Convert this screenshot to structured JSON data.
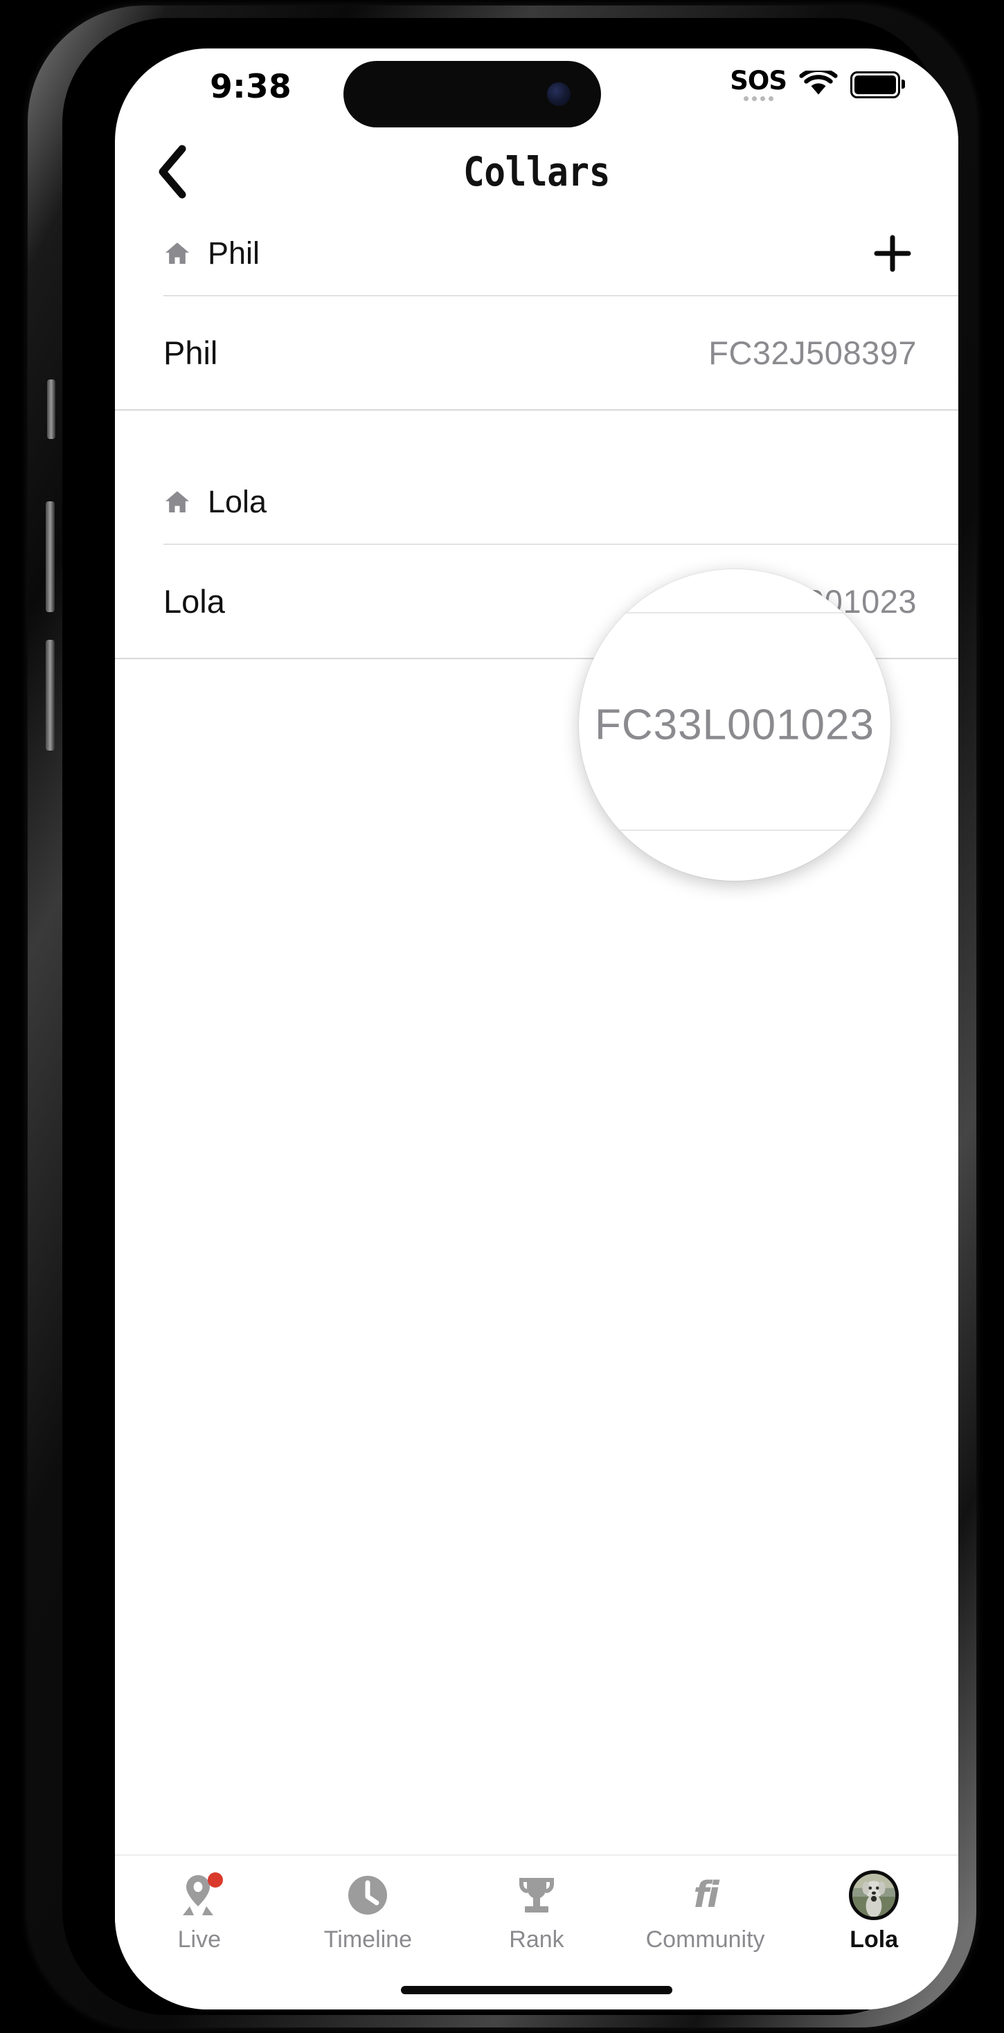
{
  "status_bar": {
    "time": "9:38",
    "sos_label": "SOS",
    "wifi_icon": "wifi-icon",
    "battery_icon": "battery-full-icon"
  },
  "nav": {
    "back_icon": "chevron-left-icon",
    "title": "Collars"
  },
  "colors": {
    "accent_badge": "#d93a2b",
    "muted_text": "#8b8b8f",
    "primary_text": "#111111",
    "divider": "#e2e2e4"
  },
  "groups": [
    {
      "house_icon": "home-icon",
      "name": "Phil",
      "add_icon": "plus-icon",
      "add_label": "+",
      "collars": [
        {
          "name": "Phil",
          "serial": "FC32J508397"
        }
      ]
    },
    {
      "house_icon": "home-icon",
      "name": "Lola",
      "collars": [
        {
          "name": "Lola",
          "serial": "FC33L001023"
        }
      ]
    }
  ],
  "magnifier": {
    "text": "FC33L001023"
  },
  "tabbar": {
    "tabs": [
      {
        "label": "Live",
        "icon": "map-pin-icon",
        "active": false,
        "badge": true
      },
      {
        "label": "Timeline",
        "icon": "clock-icon",
        "active": false,
        "badge": false
      },
      {
        "label": "Rank",
        "icon": "trophy-icon",
        "active": false,
        "badge": false
      },
      {
        "label": "Community",
        "icon": "fi-logo-icon",
        "active": false,
        "badge": false
      },
      {
        "label": "Lola",
        "icon": "dog-avatar",
        "active": true,
        "badge": false
      }
    ]
  }
}
